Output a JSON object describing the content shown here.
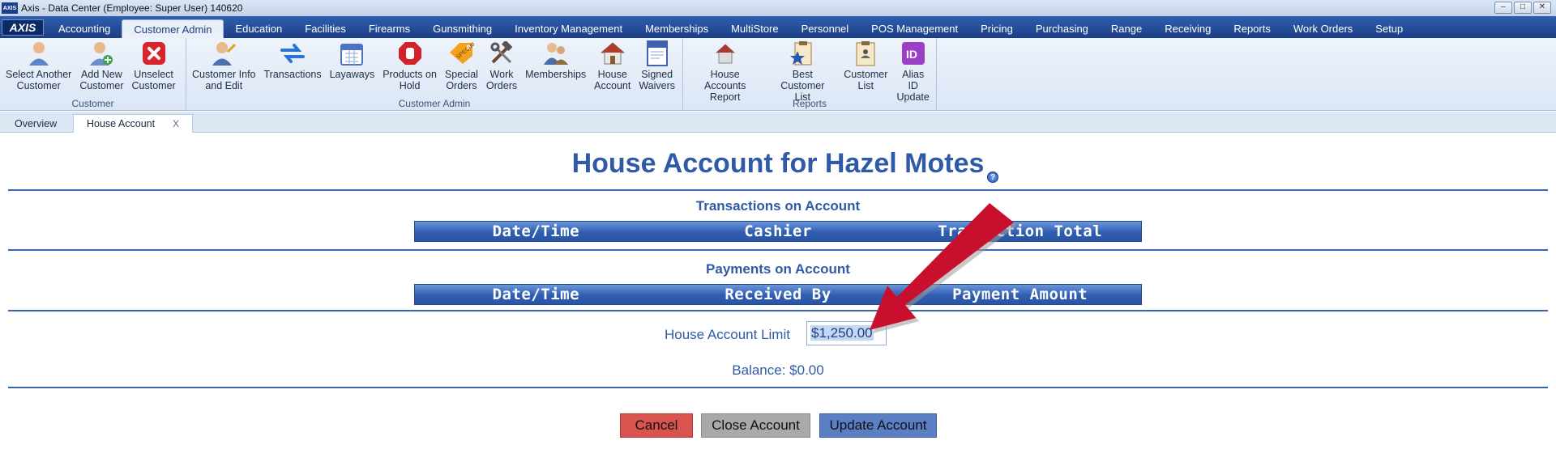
{
  "window": {
    "logo": "AXIS",
    "title": "Axis - Data Center  (Employee: Super User) 140620",
    "controls": [
      "–",
      "□",
      "✕"
    ]
  },
  "menu": {
    "brand": "AXIS",
    "tabs": [
      "Accounting",
      "Customer Admin",
      "Education",
      "Facilities",
      "Firearms",
      "Gunsmithing",
      "Inventory Management",
      "Memberships",
      "MultiStore",
      "Personnel",
      "POS Management",
      "Pricing",
      "Purchasing",
      "Range",
      "Receiving",
      "Reports",
      "Work Orders",
      "Setup"
    ],
    "active_index": 1
  },
  "ribbon": {
    "groups": [
      {
        "label": "Customer",
        "buttons": [
          {
            "label": "Select Another\nCustomer",
            "icon": "person-select-icon"
          },
          {
            "label": "Add New\nCustomer",
            "icon": "person-add-icon"
          },
          {
            "label": "Unselect\nCustomer",
            "icon": "red-x-icon"
          }
        ]
      },
      {
        "label": "Customer Admin",
        "buttons": [
          {
            "label": "Customer Info\nand Edit",
            "icon": "person-edit-icon"
          },
          {
            "label": "Transactions",
            "icon": "transfer-arrows-icon"
          },
          {
            "label": "Layaways",
            "icon": "calendar-icon"
          },
          {
            "label": "Products on\nHold",
            "icon": "stop-hand-icon"
          },
          {
            "label": "Special\nOrders",
            "icon": "special-tag-icon"
          },
          {
            "label": "Work\nOrders",
            "icon": "tools-icon"
          },
          {
            "label": "Memberships",
            "icon": "people-icon"
          },
          {
            "label": "House\nAccount",
            "icon": "house-icon"
          },
          {
            "label": "Signed\nWaivers",
            "icon": "waiver-doc-icon"
          }
        ]
      },
      {
        "label": "Reports",
        "buttons": [
          {
            "label": "House Accounts\nReport",
            "icon": "house-report-icon"
          },
          {
            "label": "Best Customer\nList",
            "icon": "star-list-icon"
          },
          {
            "label": "Customer\nList",
            "icon": "clipboard-list-icon"
          },
          {
            "label": "Alias ID\nUpdate",
            "icon": "id-badge-icon"
          }
        ]
      }
    ]
  },
  "doc_tabs": [
    {
      "label": "Overview"
    },
    {
      "label": "House Account",
      "close": "X"
    }
  ],
  "page": {
    "title": "House Account for Hazel Motes",
    "help": "?",
    "transactions": {
      "title": "Transactions on Account",
      "columns": [
        "Date/Time",
        "Cashier",
        "Transaction Total"
      ]
    },
    "payments": {
      "title": "Payments on Account",
      "columns": [
        "Date/Time",
        "Received By",
        "Payment Amount"
      ]
    },
    "limit_label": "House Account Limit",
    "limit_value": "$1,250.00",
    "balance": "Balance: $0.00",
    "buttons": {
      "cancel": "Cancel",
      "close": "Close Account",
      "update": "Update Account"
    }
  },
  "colors": {
    "accent": "#2f5aa8",
    "cancel": "#d9534f",
    "close": "#a9a9a9",
    "update": "#5b7fc4",
    "annotation_arrow": "#c8102e"
  }
}
